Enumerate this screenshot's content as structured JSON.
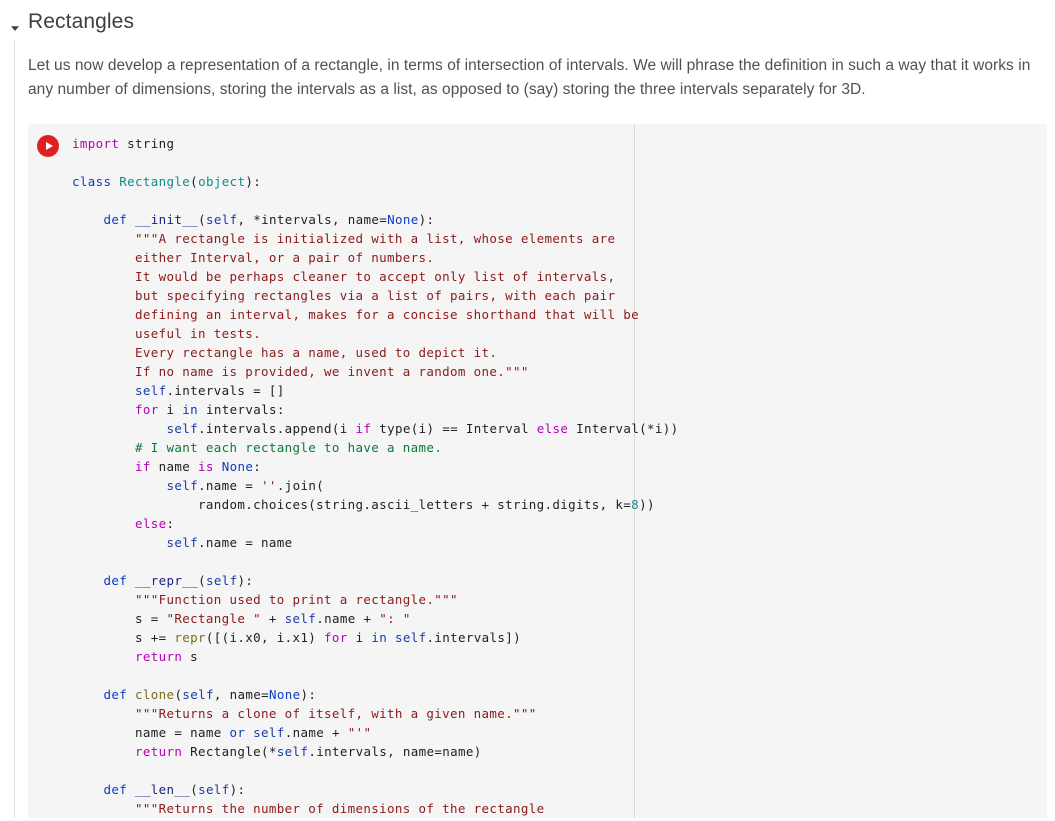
{
  "section": {
    "title": "Rectangles",
    "collapse_icon": "triangle-down-icon",
    "paragraph": "Let us now develop a representation of a rectangle, in terms of intersection of intervals. We will phrase the definition in such a way that it works in any number of dimensions, storing the intervals as a list, as opposed to (say) storing the three intervals separately for 3D."
  },
  "code_cell": {
    "run_icon": "play-icon",
    "run_icon_color": "#e02020",
    "background": "#f5f5f5",
    "ruler_color": "#d9d9d9",
    "language": "python",
    "colors": {
      "keyword": "#0d3cc4",
      "keyword_flow": "#b800b8",
      "class_name": "#118c8c",
      "function_name": "#7a6a1a",
      "self": "#1a3ca8",
      "string": "#8b1a1a",
      "comment": "#0b7a3b",
      "number": "#118c8c",
      "plain": "#202124"
    },
    "source": "import string\n\nclass Rectangle(object):\n\n    def __init__(self, *intervals, name=None):\n        \"\"\"A rectangle is initialized with a list, whose elements are\n        either Interval, or a pair of numbers.\n        It would be perhaps cleaner to accept only list of intervals,\n        but specifying rectangles via a list of pairs, with each pair\n        defining an interval, makes for a concise shorthand that will be\n        useful in tests.\n        Every rectangle has a name, used to depict it.\n        If no name is provided, we invent a random one.\"\"\"\n        self.intervals = []\n        for i in intervals:\n            self.intervals.append(i if type(i) == Interval else Interval(*i))\n        # I want each rectangle to have a name.\n        if name is None:\n            self.name = ''.join(\n                random.choices(string.ascii_letters + string.digits, k=8))\n        else:\n            self.name = name\n\n    def __repr__(self):\n        \"\"\"Function used to print a rectangle.\"\"\"\n        s = \"Rectangle \" + self.name + \": \"\n        s += repr([(i.x0, i.x1) for i in self.intervals])\n        return s\n\n    def clone(self, name=None):\n        \"\"\"Returns a clone of itself, with a given name.\"\"\"\n        name = name or self.name + \"'\"\n        return Rectangle(*self.intervals, name=name)\n\n    def __len__(self):\n        \"\"\"Returns the number of dimensions of the rectangle"
  }
}
